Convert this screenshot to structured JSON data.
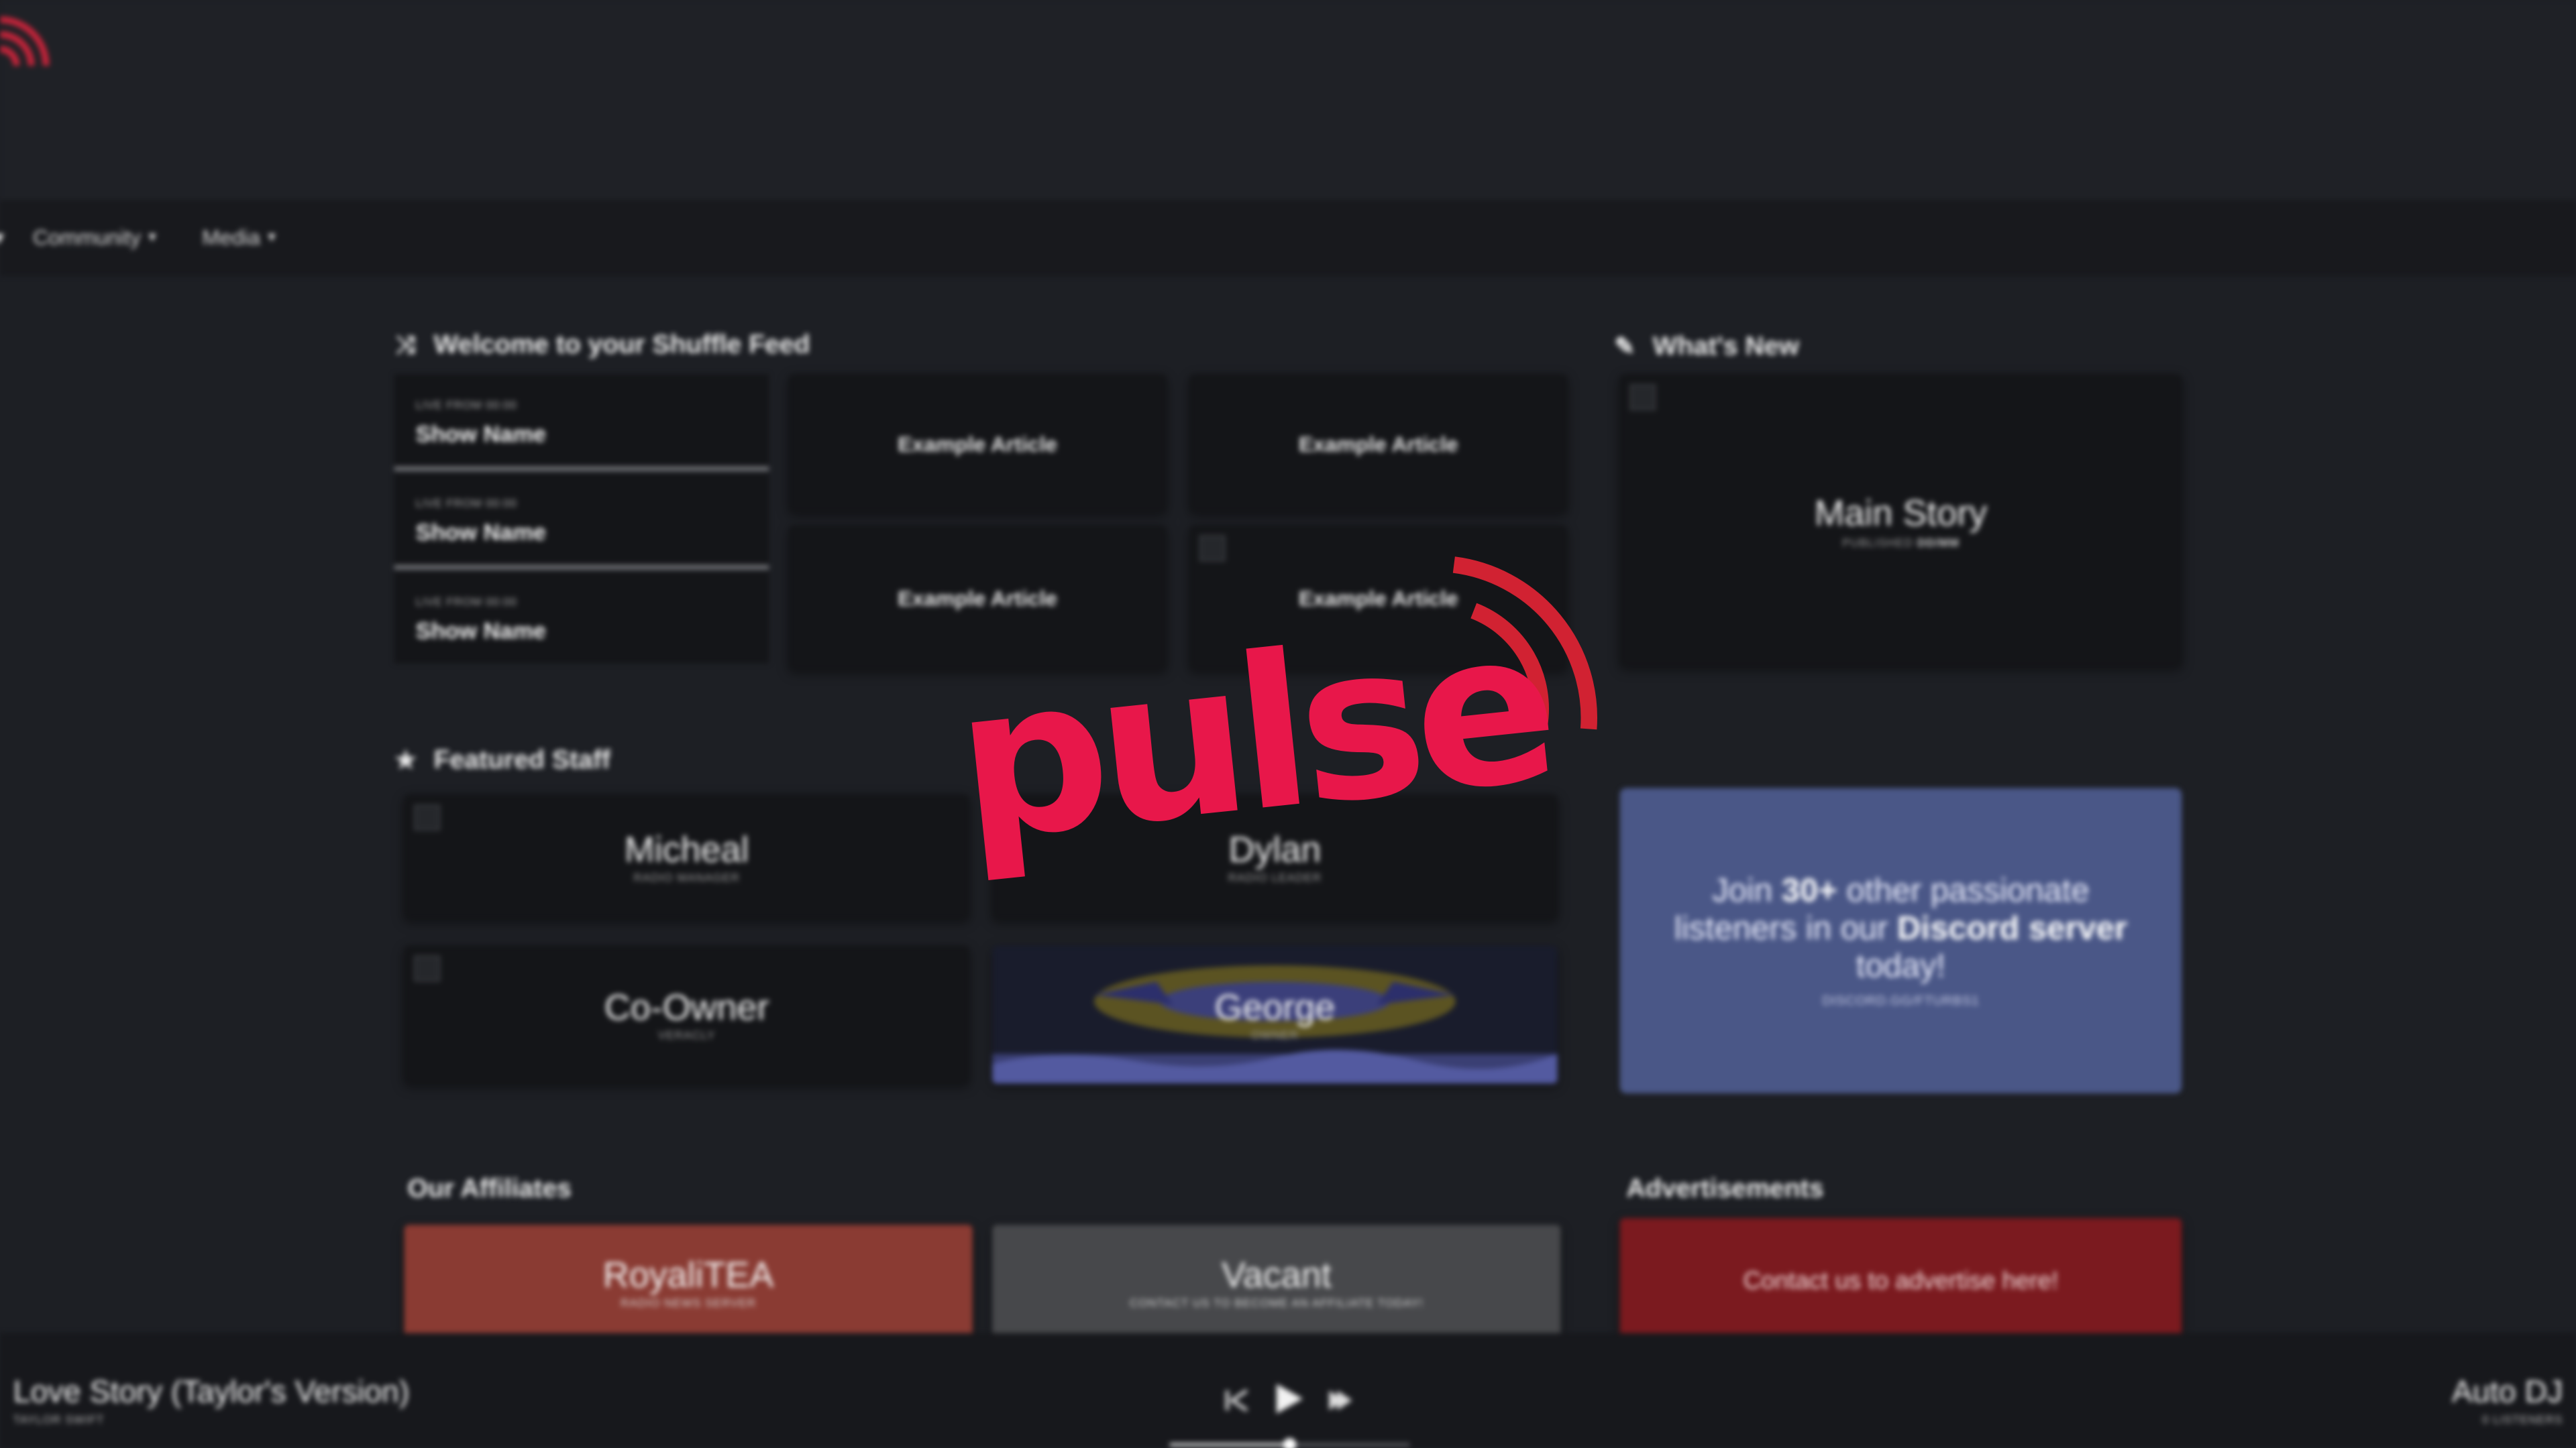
{
  "nav": {
    "items": [
      {
        "label": "Community"
      },
      {
        "label": "Media"
      }
    ]
  },
  "shuffle_feed": {
    "title": "Welcome to your Shuffle Feed",
    "shows": [
      {
        "label": "LIVE FROM 00:00",
        "name": "Show Name"
      },
      {
        "label": "LIVE FROM 00:00",
        "name": "Show Name"
      },
      {
        "label": "LIVE FROM 00:00",
        "name": "Show Name"
      }
    ],
    "articles": [
      {
        "title": "Example Article"
      },
      {
        "title": "Example Article"
      },
      {
        "title": "Example Article"
      },
      {
        "title": "Example Article"
      }
    ]
  },
  "whats_new": {
    "title": "What's New",
    "main_story": {
      "title": "Main Story",
      "published_label": "PUBLISHED",
      "published_value": "DD/MM"
    }
  },
  "featured_staff": {
    "title": "Featured Staff",
    "members": [
      {
        "name": "Micheal",
        "role": "RADIO MANAGER"
      },
      {
        "name": "Dylan",
        "role": "RADIO LEADER"
      },
      {
        "name": "Co-Owner",
        "role": "VERACLY"
      },
      {
        "name": "George",
        "role": "OWNER"
      }
    ]
  },
  "discord": {
    "text_1": "Join ",
    "count": "30+",
    "text_2": " other passionate listeners in our ",
    "server": "Discord server",
    "text_3": " today!",
    "sub": "DISCORD.GG/FTURBS1"
  },
  "affiliates": {
    "title": "Our Affiliates",
    "items": [
      {
        "name": "RoyaliTEA",
        "sub": "RADIO NEWS SERVER"
      },
      {
        "name": "Vacant",
        "sub": "CONTACT US TO BECOME AN AFFILIATE TODAY!"
      }
    ]
  },
  "advertisements": {
    "title": "Advertisements",
    "cta": "Contact us to advertise here!"
  },
  "logo": {
    "text": "pulse"
  },
  "player": {
    "track_title": "Love Story (Taylor's Version)",
    "track_artist": "TAYLOR SWIFT",
    "dj": "Auto DJ",
    "listeners": "0 LISTENERS",
    "progress": 0.5
  },
  "colors": {
    "brand": "#e8174a",
    "discord": "#4a5787",
    "royalitea": "#8a3b33",
    "vacant": "#47484b",
    "ad": "#7b1a1f"
  },
  "icons": {
    "shuffle": "shuffle-icon",
    "whats_new": "megaphone-icon",
    "featured": "star-icon",
    "previous": "previous-icon",
    "play": "play-icon",
    "next": "next-icon"
  }
}
